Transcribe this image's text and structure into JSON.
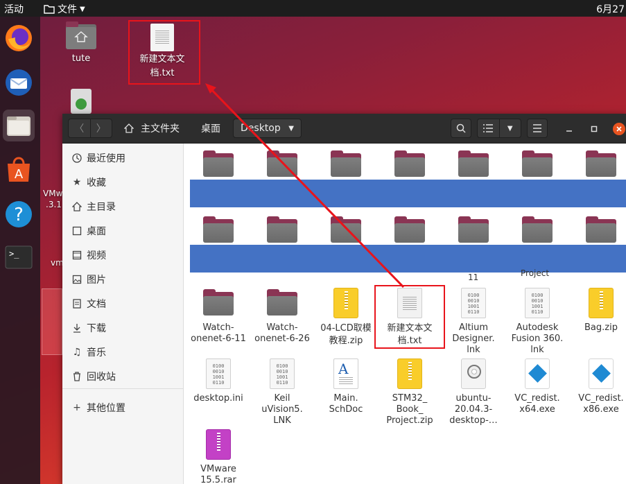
{
  "topbar": {
    "activities": "活动",
    "app_menu": "文件",
    "clock": "6月27"
  },
  "desktop": {
    "icons": [
      {
        "name": "tute"
      },
      {
        "name": "新建文本文\n档.txt"
      }
    ],
    "partial_labels": [
      "VMw",
      ".3.1",
      "vm"
    ]
  },
  "window": {
    "breadcrumbs": [
      "主文件夹",
      "桌面",
      "Desktop"
    ],
    "sidebar": [
      {
        "label": "最近使用",
        "icon": "clock-icon"
      },
      {
        "label": "收藏",
        "icon": "star-icon"
      },
      {
        "label": "主目录",
        "icon": "home-icon"
      },
      {
        "label": "桌面",
        "icon": "desktop-icon"
      },
      {
        "label": "视频",
        "icon": "video-icon"
      },
      {
        "label": "图片",
        "icon": "image-icon"
      },
      {
        "label": "文档",
        "icon": "document-icon"
      },
      {
        "label": "下载",
        "icon": "download-icon"
      },
      {
        "label": "音乐",
        "icon": "music-icon"
      },
      {
        "label": "回收站",
        "icon": "trash-icon"
      },
      {
        "label": "其他位置",
        "icon": "plus-icon"
      }
    ],
    "cut_labels": [
      "11",
      "Project"
    ],
    "files_row1": [
      {
        "label": "Watch-\nonenet-6-11",
        "type": "folder"
      },
      {
        "label": "Watch-\nonenet-6-26",
        "type": "folder"
      },
      {
        "label": "04-LCD取模\n教程.zip",
        "type": "zip"
      },
      {
        "label": "新建文本文\n档.txt",
        "type": "txt"
      },
      {
        "label": "Altium\nDesigner.\nlnk",
        "type": "binary"
      },
      {
        "label": "Autodesk\nFusion 360.\nlnk",
        "type": "binary"
      },
      {
        "label": "Bag.zip",
        "type": "zip"
      }
    ],
    "files_row2": [
      {
        "label": "desktop.ini",
        "type": "binary"
      },
      {
        "label": "Keil\nuVision5.\nLNK",
        "type": "binary"
      },
      {
        "label": "Main.\nSchDoc",
        "type": "schdoc"
      },
      {
        "label": "STM32_\nBook_\nProject.zip",
        "type": "zip"
      },
      {
        "label": "ubuntu-\n20.04.3-\ndesktop-…",
        "type": "iso"
      },
      {
        "label": "VC_redist.\nx64.exe",
        "type": "exe"
      },
      {
        "label": "VC_redist.\nx86.exe",
        "type": "exe"
      }
    ],
    "files_row3": [
      {
        "label": "VMware\n15.5.rar",
        "type": "rar"
      }
    ]
  },
  "colors": {
    "annotation_red": "#e8141b",
    "blue_bar": "#4472c4",
    "folder_tab": "#8a3554",
    "close_button": "#e95420"
  }
}
